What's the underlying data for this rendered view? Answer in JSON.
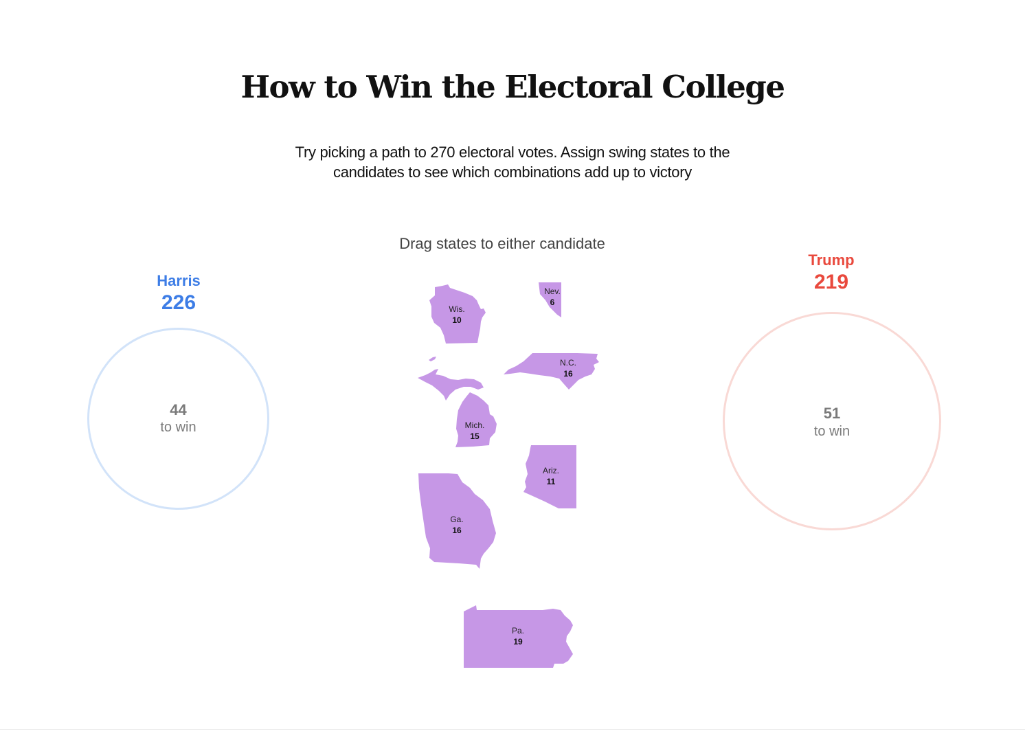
{
  "title": "How to Win the Electoral College",
  "subtitle_line1": "Try picking a path to 270 electoral votes. Assign swing states to the",
  "subtitle_line2": "candidates to see which combinations add up to victory",
  "drag_label": "Drag states to either candidate",
  "colors": {
    "harris": "#3d7de6",
    "trump": "#e9493d",
    "state_fill": "#c697e6",
    "harris_ring": "#d2e3f9",
    "trump_ring": "#f9d9d5"
  },
  "harris": {
    "name": "Harris",
    "votes": "226",
    "to_win_number": "44",
    "to_win_label": "to win"
  },
  "trump": {
    "name": "Trump",
    "votes": "219",
    "to_win_number": "51",
    "to_win_label": "to win"
  },
  "states": {
    "nv": {
      "abbr": "Nev.",
      "votes": "6"
    },
    "wi": {
      "abbr": "Wis.",
      "votes": "10"
    },
    "nc": {
      "abbr": "N.C.",
      "votes": "16"
    },
    "mi": {
      "abbr": "Mich.",
      "votes": "15"
    },
    "az": {
      "abbr": "Ariz.",
      "votes": "11"
    },
    "ga": {
      "abbr": "Ga.",
      "votes": "16"
    },
    "pa": {
      "abbr": "Pa.",
      "votes": "19"
    }
  }
}
